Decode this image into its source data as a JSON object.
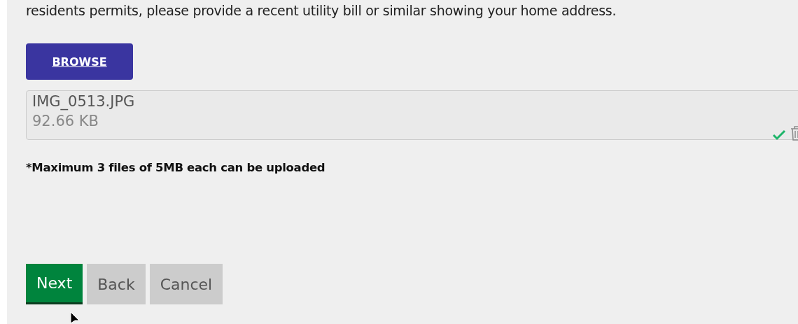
{
  "instructions": "residents permits, please provide a recent utility bill or similar showing your home address.",
  "browse_button": {
    "label": "BROWSE"
  },
  "files": [
    {
      "name": "IMG_0513.JPG",
      "size": "92.66 KB",
      "uploaded": true
    }
  ],
  "note": "*Maximum 3 files of 5MB each can be uploaded",
  "buttons": [
    {
      "label": "Next",
      "kind": "primary"
    },
    {
      "label": "Back",
      "kind": "secondary"
    },
    {
      "label": "Cancel",
      "kind": "secondary"
    }
  ]
}
